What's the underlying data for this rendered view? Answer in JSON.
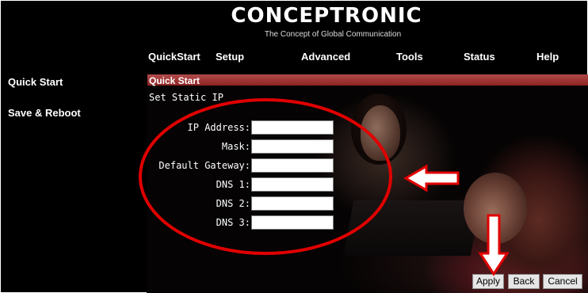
{
  "brand": {
    "logo": "CONCEPTRONIC",
    "tagline": "The Concept of Global Communication"
  },
  "nav": [
    "QuickStart",
    "Setup",
    "Advanced",
    "Tools",
    "Status",
    "Help"
  ],
  "sidebar": [
    "Quick Start",
    "Save & Reboot"
  ],
  "section": {
    "title": "Quick Start",
    "subtitle": "Set Static IP"
  },
  "form": {
    "fields": [
      {
        "label": "IP Address:",
        "value": ""
      },
      {
        "label": "Mask:",
        "value": ""
      },
      {
        "label": "Default Gateway:",
        "value": ""
      },
      {
        "label": "DNS 1:",
        "value": ""
      },
      {
        "label": "DNS 2:",
        "value": ""
      },
      {
        "label": "DNS 3:",
        "value": ""
      }
    ]
  },
  "buttons": {
    "apply": "Apply",
    "back": "Back",
    "cancel": "Cancel"
  },
  "colors": {
    "section_bar": "#9a2e2e",
    "annotation_red": "#e00000"
  }
}
